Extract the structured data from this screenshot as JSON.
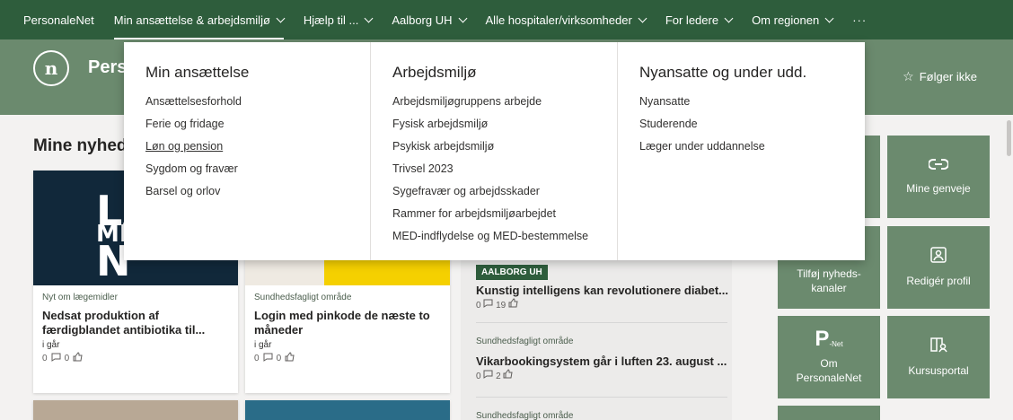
{
  "topnav": {
    "brand": "PersonaleNet",
    "items": [
      {
        "label": "Min ansættelse & arbejdsmiljø",
        "has_dropdown": true
      },
      {
        "label": "Hjælp til ...",
        "has_dropdown": true
      },
      {
        "label": "Aalborg UH",
        "has_dropdown": true
      },
      {
        "label": "Alle hospitaler/virksomheder",
        "has_dropdown": true
      },
      {
        "label": "For ledere",
        "has_dropdown": true
      },
      {
        "label": "Om regionen",
        "has_dropdown": true
      }
    ],
    "more": "···"
  },
  "header": {
    "logo_letter": "n",
    "site_title": "Pers",
    "follow_label": "Følger ikke"
  },
  "mega_menu": {
    "columns": [
      {
        "heading": "Min ansættelse",
        "links": [
          "Ansættelsesforhold",
          "Ferie og fridage",
          "Løn og pension",
          "Sygdom og fravær",
          "Barsel og orlov"
        ]
      },
      {
        "heading": "Arbejdsmiljø",
        "links": [
          "Arbejdsmiljøgruppens arbejde",
          "Fysisk arbejdsmiljø",
          "Psykisk arbejdsmiljø",
          "Trivsel 2023",
          "Sygefravær og arbejdsskader",
          "Rammer for arbejdsmiljøarbejdet",
          "MED-indflydelse og MED-bestemmelse"
        ]
      },
      {
        "heading": "Nyansatte og under udd.",
        "links": [
          "Nyansatte",
          "Studerende",
          "Læger under uddannelse"
        ]
      }
    ]
  },
  "main": {
    "section_title": "Mine nyhed",
    "cards": [
      {
        "thumb_text": [
          "LA",
          "MI",
          "N"
        ],
        "category": "Nyt om lægemidler",
        "headline": "Nedsat produktion af færdigblandet antibiotika til...",
        "when": "i går",
        "comments": "0",
        "likes": "0"
      },
      {
        "category": "Sundhedsfagligt område",
        "headline": "Login med pinkode de næste to måneder",
        "when": "i går",
        "comments": "0",
        "likes": "0"
      }
    ],
    "news": [
      {
        "tag": "AALBORG UH",
        "title": "Kunstig intelligens kan revolutionere diabet...",
        "comments": "0",
        "likes": "19"
      },
      {
        "category": "Sundhedsfagligt område",
        "title": "Vikarbookingsystem går i luften 23. august ...",
        "comments": "0",
        "likes": "2"
      },
      {
        "category": "Sundhedsfagligt område"
      }
    ]
  },
  "tiles": [
    {
      "label": "Mine genveje",
      "icon": "link-icon"
    },
    {
      "label": "Tilføj nyheds-kanaler",
      "icon": "none"
    },
    {
      "label": "Redigér profil",
      "icon": "profile-image-icon"
    },
    {
      "label": "Om PersonaleNet",
      "icon": "p-net-logo-icon",
      "icon_text": "P",
      "icon_sub": "-Net"
    },
    {
      "label": "Kursusportal",
      "icon": "book-person-icon"
    }
  ],
  "colors": {
    "nav_bg": "#2e5d3c",
    "header_bg": "#6b8a6e",
    "tile_bg": "#6b8a6e",
    "page_bg": "#f3f2f1"
  }
}
